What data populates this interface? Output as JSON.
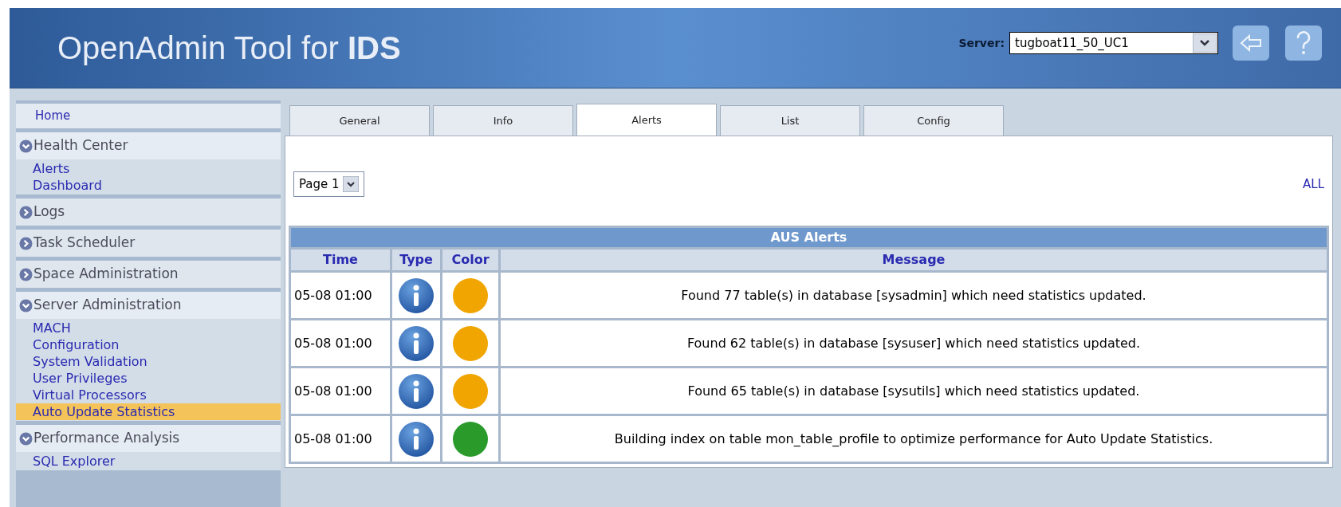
{
  "header": {
    "title": "OpenAdmin Tool for **IDS**",
    "server_label": "Server:",
    "server_value": "tugboat11_50_UC1"
  },
  "sidebar": [
    {
      "kind": "link",
      "label": "Home"
    },
    {
      "kind": "section",
      "label": "Health Center",
      "expanded": true,
      "children": [
        {
          "label": "Alerts",
          "selected": false
        },
        {
          "label": "Dashboard",
          "selected": false
        }
      ]
    },
    {
      "kind": "section",
      "label": "Logs",
      "expanded": false
    },
    {
      "kind": "section",
      "label": "Task Scheduler",
      "expanded": false
    },
    {
      "kind": "section",
      "label": "Space Administration",
      "expanded": false
    },
    {
      "kind": "section",
      "label": "Server Administration",
      "expanded": true,
      "children": [
        {
          "label": "MACH",
          "selected": false
        },
        {
          "label": "Configuration",
          "selected": false
        },
        {
          "label": "System Validation",
          "selected": false
        },
        {
          "label": "User Privileges",
          "selected": false
        },
        {
          "label": "Virtual Processors",
          "selected": false
        },
        {
          "label": "Auto Update Statistics",
          "selected": true
        }
      ]
    },
    {
      "kind": "section",
      "label": "Performance Analysis",
      "expanded": true,
      "children": [
        {
          "label": "SQL Explorer",
          "selected": false
        }
      ]
    }
  ],
  "tabs": [
    {
      "label": "General",
      "selected": false
    },
    {
      "label": "Info",
      "selected": false
    },
    {
      "label": "Alerts",
      "selected": true
    },
    {
      "label": "List",
      "selected": false
    },
    {
      "label": "Config",
      "selected": false
    }
  ],
  "pager": {
    "value": "Page 1",
    "all_link": "ALL"
  },
  "table": {
    "title": "AUS Alerts",
    "columns": [
      "Time",
      "Type",
      "Color",
      "Message"
    ],
    "rows": [
      {
        "time": "05-08 01:00",
        "kind": "info",
        "color": "#f0a500",
        "message": "Found 77 table(s) in database [sysadmin] which need statistics updated."
      },
      {
        "time": "05-08 01:00",
        "kind": "info",
        "color": "#f0a500",
        "message": "Found 62 table(s) in database [sysuser] which need statistics updated."
      },
      {
        "time": "05-08 01:00",
        "kind": "info",
        "color": "#f0a500",
        "message": "Found 65 table(s) in database [sysutils] which need statistics updated."
      },
      {
        "time": "05-08 01:00",
        "kind": "info",
        "color": "#2a9a2a",
        "message": "Building index on table mon_table_profile to optimize performance for Auto Update Statistics."
      }
    ]
  }
}
